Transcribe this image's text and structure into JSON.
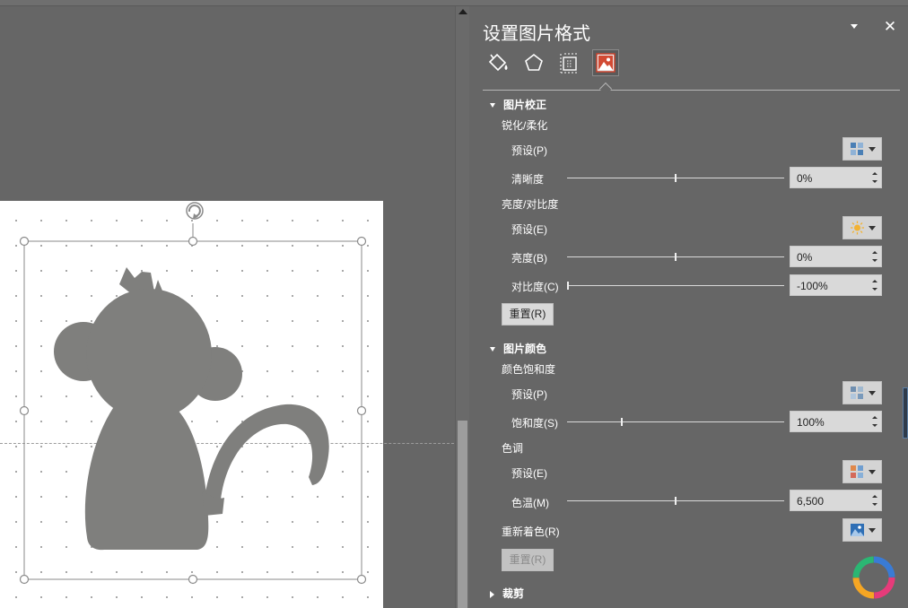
{
  "pane": {
    "title": "设置图片格式",
    "tabs": [
      {
        "name": "fill-line",
        "icon": "paint-bucket-icon"
      },
      {
        "name": "effects",
        "icon": "pentagon-icon"
      },
      {
        "name": "size-properties",
        "icon": "size-properties-icon"
      },
      {
        "name": "picture",
        "icon": "picture-icon",
        "active": true
      }
    ]
  },
  "correction": {
    "title": "图片校正",
    "sharpen_soften": {
      "label": "锐化/柔化",
      "preset_label": "预设(P)",
      "clarity_label": "清晰度",
      "clarity_value": "0%",
      "clarity_level": 0.5
    },
    "brightness_contrast": {
      "label": "亮度/对比度",
      "preset_label": "预设(E)",
      "brightness_label": "亮度(B)",
      "brightness_value": "0%",
      "brightness_level": 0.5,
      "contrast_label": "对比度(C)",
      "contrast_value": "-100%",
      "contrast_level": 0.0
    },
    "reset_label": "重置(R)"
  },
  "color": {
    "title": "图片颜色",
    "saturation": {
      "label": "颜色饱和度",
      "preset_label": "预设(P)",
      "saturation_label": "饱和度(S)",
      "saturation_value": "100%",
      "saturation_level": 0.25
    },
    "tone": {
      "label": "色调",
      "preset_label": "预设(E)",
      "temperature_label": "色温(M)",
      "temperature_value": "6,500",
      "temperature_level": 0.5
    },
    "recolor_label": "重新着色(R)",
    "reset_label": "重置(R)"
  },
  "crop": {
    "title": "裁剪"
  },
  "colors": {
    "background": "#666666",
    "slide": "#ffffff",
    "monkey": "#7f7f7d",
    "handle": "#8a8a8a"
  }
}
